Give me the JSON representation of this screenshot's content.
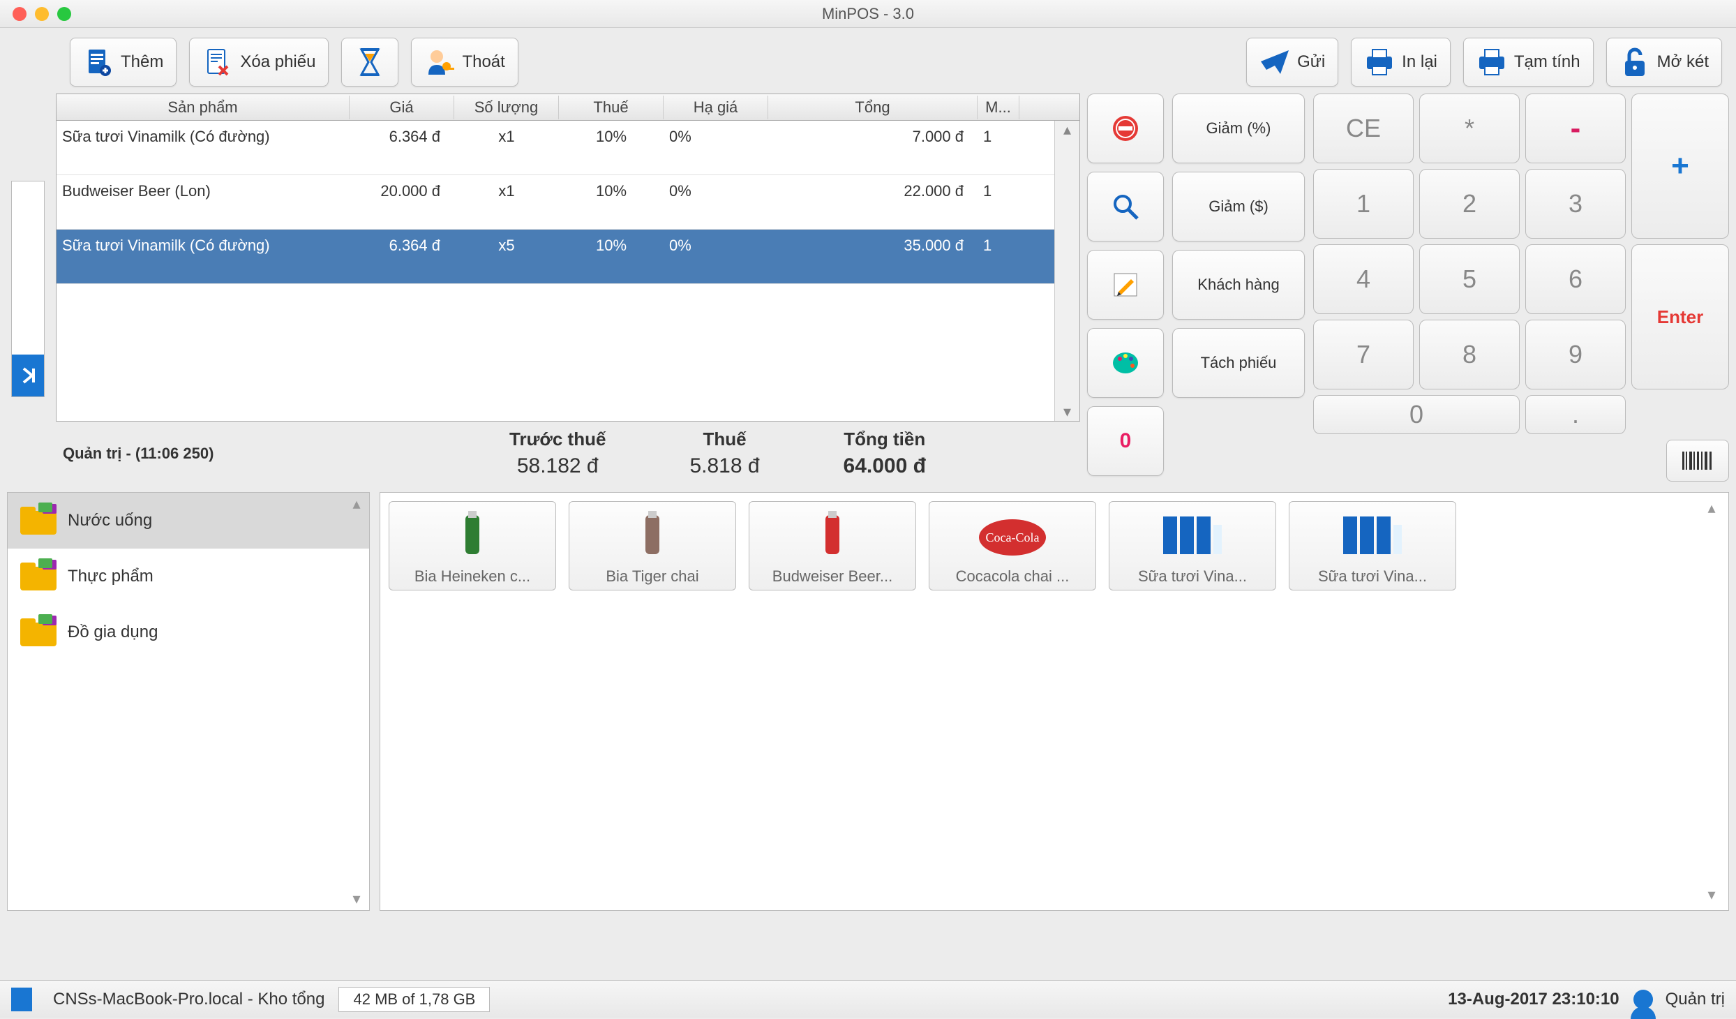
{
  "window": {
    "title": "MinPOS - 3.0"
  },
  "toolbar": {
    "add": "Thêm",
    "delete": "Xóa phiếu",
    "logout": "Thoát",
    "send": "Gửi",
    "reprint": "In lại",
    "preprint": "Tạm tính",
    "opendrawer": "Mở két"
  },
  "table": {
    "headers": {
      "product": "Sản phẩm",
      "price": "Giá",
      "qty": "Số lượng",
      "tax": "Thuế",
      "discount": "Hạ giá",
      "total": "Tổng",
      "m": "M..."
    },
    "rows": [
      {
        "product": "Sữa tươi Vinamilk (Có đường)",
        "price": "6.364 đ",
        "qty": "x1",
        "tax": "10%",
        "discount": "0%",
        "total": "7.000 đ",
        "m": "1",
        "selected": false
      },
      {
        "product": "Budweiser Beer (Lon)",
        "price": "20.000 đ",
        "qty": "x1",
        "tax": "10%",
        "discount": "0%",
        "total": "22.000 đ",
        "m": "1",
        "selected": false
      },
      {
        "product": "Sữa tươi Vinamilk (Có đường)",
        "price": "6.364 đ",
        "qty": "x5",
        "tax": "10%",
        "discount": "0%",
        "total": "35.000 đ",
        "m": "1",
        "selected": true
      }
    ]
  },
  "info": {
    "user_line": "Quản trị - (11:06 250)"
  },
  "totals": {
    "pretax_label": "Trước thuế",
    "pretax_value": "58.182 đ",
    "tax_label": "Thuế",
    "tax_value": "5.818 đ",
    "grand_label": "Tổng tiền",
    "grand_value": "64.000 đ"
  },
  "actions": {
    "disc_pct": "Giảm (%)",
    "disc_amt": "Giảm ($)",
    "customer": "Khách hàng",
    "split": "Tách phiếu",
    "zero": "0"
  },
  "keypad": {
    "ce": "CE",
    "star": "*",
    "minus": "-",
    "k1": "1",
    "k2": "2",
    "k3": "3",
    "plus": "+",
    "k4": "4",
    "k5": "5",
    "k6": "6",
    "k7": "7",
    "k8": "8",
    "k9": "9",
    "enter": "Enter",
    "k0": "0",
    "dot": "."
  },
  "categories": {
    "items": [
      {
        "label": "Nước uống",
        "selected": true
      },
      {
        "label": "Thực phẩm",
        "selected": false
      },
      {
        "label": "Đồ gia dụng",
        "selected": false
      }
    ]
  },
  "products": {
    "items": [
      {
        "name": "Bia Heineken c..."
      },
      {
        "name": "Bia Tiger chai"
      },
      {
        "name": "Budweiser Beer..."
      },
      {
        "name": "Cocacola chai ..."
      },
      {
        "name": "Sữa tươi Vina..."
      },
      {
        "name": "Sữa tươi Vina..."
      }
    ]
  },
  "statusbar": {
    "host": "CNSs-MacBook-Pro.local - Kho tổng",
    "memory": "42 MB of 1,78 GB",
    "datetime": "13-Aug-2017 23:10:10",
    "user": "Quản trị"
  }
}
